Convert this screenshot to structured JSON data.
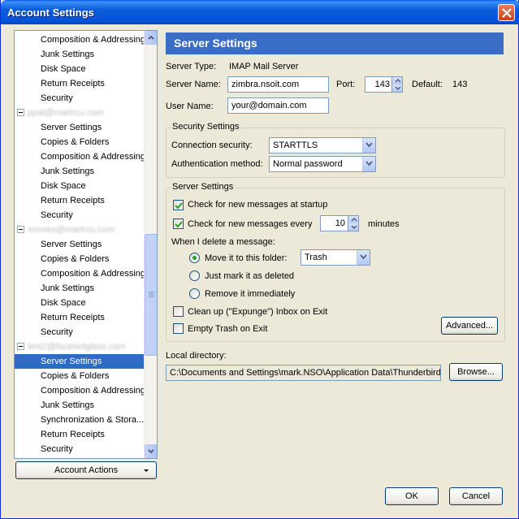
{
  "window": {
    "title": "Account Settings"
  },
  "tree": {
    "rows": [
      {
        "label": "Composition & Addressing",
        "kind": "item"
      },
      {
        "label": "Junk Settings",
        "kind": "item"
      },
      {
        "label": "Disk Space",
        "kind": "item"
      },
      {
        "label": "Return Receipts",
        "kind": "item"
      },
      {
        "label": "Security",
        "kind": "item"
      },
      {
        "label": "ppat@martrcu.com",
        "kind": "account"
      },
      {
        "label": "Server Settings",
        "kind": "item"
      },
      {
        "label": "Copies & Folders",
        "kind": "item"
      },
      {
        "label": "Composition & Addressing",
        "kind": "item"
      },
      {
        "label": "Junk Settings",
        "kind": "item"
      },
      {
        "label": "Disk Space",
        "kind": "item"
      },
      {
        "label": "Return Receipts",
        "kind": "item"
      },
      {
        "label": "Security",
        "kind": "item"
      },
      {
        "label": "movies@martrcu.com",
        "kind": "account"
      },
      {
        "label": "Server Settings",
        "kind": "item"
      },
      {
        "label": "Copies & Folders",
        "kind": "item"
      },
      {
        "label": "Composition & Addressing",
        "kind": "item"
      },
      {
        "label": "Junk Settings",
        "kind": "item"
      },
      {
        "label": "Disk Space",
        "kind": "item"
      },
      {
        "label": "Return Receipts",
        "kind": "item"
      },
      {
        "label": "Security",
        "kind": "item"
      },
      {
        "label": "test2@facetedglass.com",
        "kind": "account"
      },
      {
        "label": "Server Settings",
        "kind": "item",
        "selected": true
      },
      {
        "label": "Copies & Folders",
        "kind": "item"
      },
      {
        "label": "Composition & Addressing",
        "kind": "item"
      },
      {
        "label": "Junk Settings",
        "kind": "item"
      },
      {
        "label": "Synchronization & Stora...",
        "kind": "item"
      },
      {
        "label": "Return Receipts",
        "kind": "item"
      },
      {
        "label": "Security",
        "kind": "item"
      }
    ]
  },
  "account_actions": {
    "label": "Account Actions"
  },
  "panel": {
    "header": "Server Settings",
    "server_type_label": "Server Type:",
    "server_type_value": "IMAP Mail Server",
    "server_name_label": "Server Name:",
    "server_name_value": "zimbra.nsoit.com",
    "port_label": "Port:",
    "port_value": "143",
    "default_label": "Default:",
    "default_value": "143",
    "user_name_label": "User Name:",
    "user_name_value": "your@domain.com"
  },
  "security": {
    "title": "Security Settings",
    "conn_label": "Connection security:",
    "conn_value": "STARTTLS",
    "auth_label": "Authentication method:",
    "auth_value": "Normal password"
  },
  "server": {
    "title": "Server Settings",
    "check_startup": "Check for new messages at startup",
    "check_every": "Check for new messages every",
    "minutes_value": "10",
    "minutes_label": "minutes",
    "when_delete": "When I delete a message:",
    "move_to": "Move it to this folder:",
    "folder_value": "Trash",
    "mark_deleted": "Just mark it as deleted",
    "remove_immediately": "Remove it immediately",
    "cleanup": "Clean up (\"Expunge\") Inbox on Exit",
    "empty_trash": "Empty Trash on Exit",
    "advanced": "Advanced..."
  },
  "local": {
    "label": "Local directory:",
    "path": "C:\\Documents and Settings\\mark.NSO\\Application Data\\Thunderbird\\",
    "browse": "Browse..."
  },
  "buttons": {
    "ok": "OK",
    "cancel": "Cancel"
  },
  "colors": {
    "title_blue": "#0b5ed7",
    "header_blue": "#3a6ec6",
    "selection": "#316ac5",
    "dialog_bg": "#ece9d8"
  }
}
